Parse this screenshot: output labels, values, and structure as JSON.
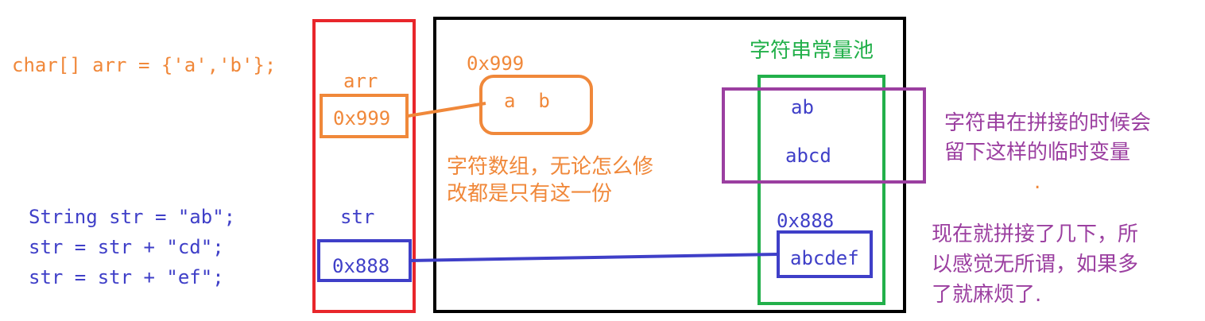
{
  "code_char": "char[] arr = {'a','b'};",
  "code_string": [
    "String str = \"ab\";",
    "str = str + \"cd\";",
    "str = str + \"ef\";"
  ],
  "stack": {
    "arr_label": "arr",
    "arr_value": "0x999",
    "str_label": "str",
    "str_value": "0x888"
  },
  "heap": {
    "array_address": "0x999",
    "array_elements": "a  b",
    "array_note": [
      "字符数组，无论怎么修",
      "改都是只有这一份"
    ],
    "pool_title": "字符串常量池",
    "pool_items": [
      "ab",
      "abcd"
    ],
    "string_address": "0x888",
    "string_value": "abcdef"
  },
  "notes": {
    "temp_vars": [
      "字符串在拼接的时候会",
      "留下这样的临时变量"
    ],
    "dot": ".",
    "concat_note": [
      "现在就拼接了几下，所",
      "以感觉无所谓，如果多",
      "了就麻烦了."
    ]
  },
  "colors": {
    "orange": "#f0883a",
    "red": "#e8262b",
    "blue": "#3f3fc8",
    "green": "#22b04a",
    "purple": "#9b3fa0",
    "black": "#000000"
  }
}
